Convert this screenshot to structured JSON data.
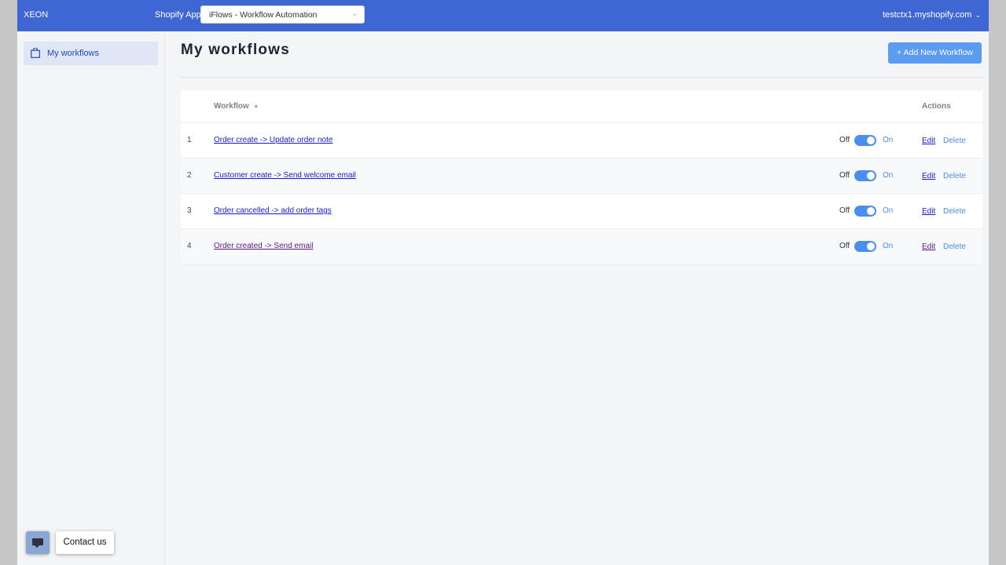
{
  "topbar": {
    "brand": "XEON",
    "app_label": "Shopify App:",
    "app_selected": "iFlows - Workflow Automation",
    "store": "testctx1.myshopify.com",
    "colors": {
      "bar": "#3f67d4"
    }
  },
  "sidebar": {
    "items": [
      {
        "label": "My workflows",
        "icon": "shopping-bag-icon",
        "active": true
      }
    ]
  },
  "main": {
    "title": "My workflows",
    "add_button": "+ Add New Workflow",
    "table": {
      "headers": {
        "workflow": "Workflow",
        "actions": "Actions"
      },
      "rows": [
        {
          "num": "1",
          "name": "Order create -> Update order note",
          "off": "Off",
          "on": "On",
          "enabled": true,
          "edit": "Edit",
          "delete": "Delete"
        },
        {
          "num": "2",
          "name": "Customer create -> Send welcome email",
          "off": "Off",
          "on": "On",
          "enabled": true,
          "edit": "Edit",
          "delete": "Delete"
        },
        {
          "num": "3",
          "name": "Order cancelled -> add order tags",
          "off": "Off",
          "on": "On",
          "enabled": true,
          "edit": "Edit",
          "delete": "Delete"
        },
        {
          "num": "4",
          "name": "Order created -> Send email",
          "off": "Off",
          "on": "On",
          "enabled": true,
          "edit": "Edit",
          "delete": "Delete"
        }
      ]
    }
  },
  "chat": {
    "contact_label": "Contact us",
    "icon": "chat-icon"
  }
}
